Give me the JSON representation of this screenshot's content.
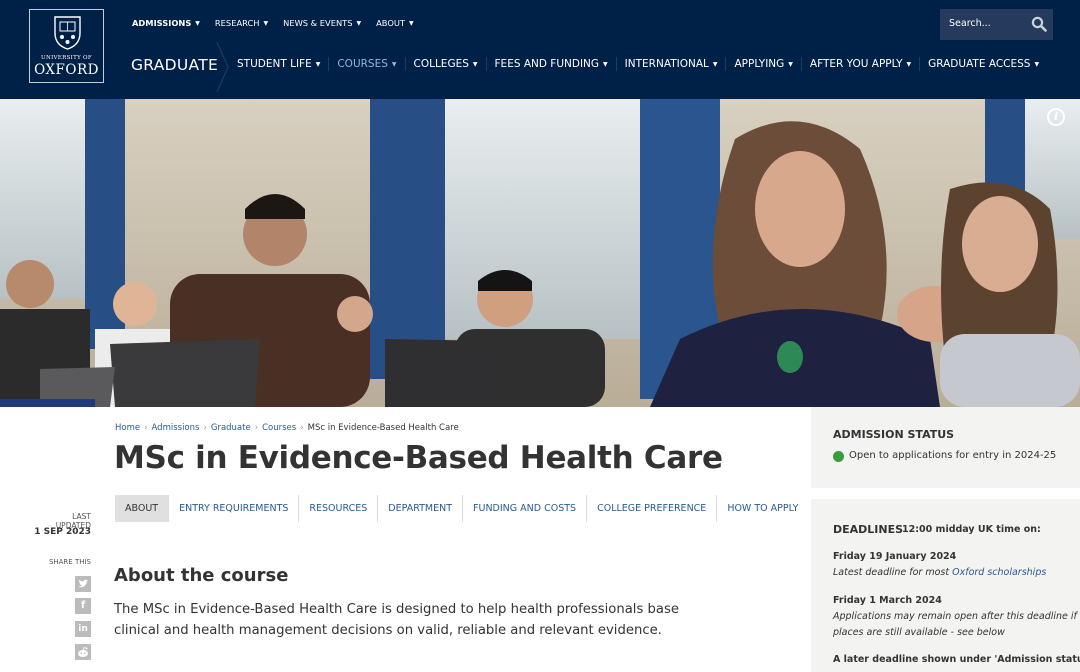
{
  "logo": {
    "university": "UNIVERSITY OF",
    "name": "OXFORD"
  },
  "topnav": [
    {
      "label": "ADMISSIONS",
      "bold": true
    },
    {
      "label": "RESEARCH",
      "bold": false
    },
    {
      "label": "NEWS & EVENTS",
      "bold": false
    },
    {
      "label": "ABOUT",
      "bold": false
    }
  ],
  "search": {
    "placeholder": "Search..."
  },
  "section": "GRADUATE",
  "mainnav": [
    {
      "label": "STUDENT LIFE",
      "active": false
    },
    {
      "label": "COURSES",
      "active": true
    },
    {
      "label": "COLLEGES",
      "active": false
    },
    {
      "label": "FEES AND FUNDING",
      "active": false
    },
    {
      "label": "INTERNATIONAL",
      "active": false
    },
    {
      "label": "APPLYING",
      "active": false
    },
    {
      "label": "AFTER YOU APPLY",
      "active": false
    },
    {
      "label": "GRADUATE ACCESS",
      "active": false
    }
  ],
  "breadcrumb": [
    "Home",
    "Admissions",
    "Graduate",
    "Courses",
    "MSc in Evidence-Based Health Care"
  ],
  "page_title": "MSc in Evidence-Based Health Care",
  "tabs": [
    {
      "label": "ABOUT",
      "active": true
    },
    {
      "label": "ENTRY REQUIREMENTS",
      "active": false
    },
    {
      "label": "RESOURCES",
      "active": false
    },
    {
      "label": "DEPARTMENT",
      "active": false
    },
    {
      "label": "FUNDING AND COSTS",
      "active": false
    },
    {
      "label": "COLLEGE PREFERENCE",
      "active": false
    },
    {
      "label": "HOW TO APPLY",
      "active": false
    }
  ],
  "last_updated": {
    "label": "LAST UPDATED",
    "date": "1 SEP 2023"
  },
  "share": {
    "label": "SHARE THIS",
    "icons": [
      "twitter-icon",
      "facebook-icon",
      "linkedin-icon",
      "reddit-icon"
    ]
  },
  "about": {
    "heading": "About the course",
    "text": "The MSc in Evidence-Based Health Care is designed to help health professionals base clinical and health management decisions on valid, reliable and relevant evidence."
  },
  "admission_status": {
    "heading": "ADMISSION STATUS",
    "status": "Open to applications for entry in 2024-25",
    "status_color": "#3a9c3a"
  },
  "deadlines": {
    "heading": "DEADLINES",
    "subheading": "12:00 midday UK time on:",
    "items": [
      {
        "date": "Friday 19 January 2024",
        "note_prefix": "Latest deadline for most ",
        "note_link": "Oxford scholarships",
        "note_suffix": ""
      },
      {
        "date": "Friday 1 March 2024",
        "note_line1": "Applications may remain open after this deadline if",
        "note_line2": "places are still available - see below"
      }
    ],
    "later": "A later deadline shown under 'Admission status'"
  },
  "colors": {
    "navy": "#002147",
    "link": "#2a5a92",
    "active_nav": "#8fb8e0"
  }
}
